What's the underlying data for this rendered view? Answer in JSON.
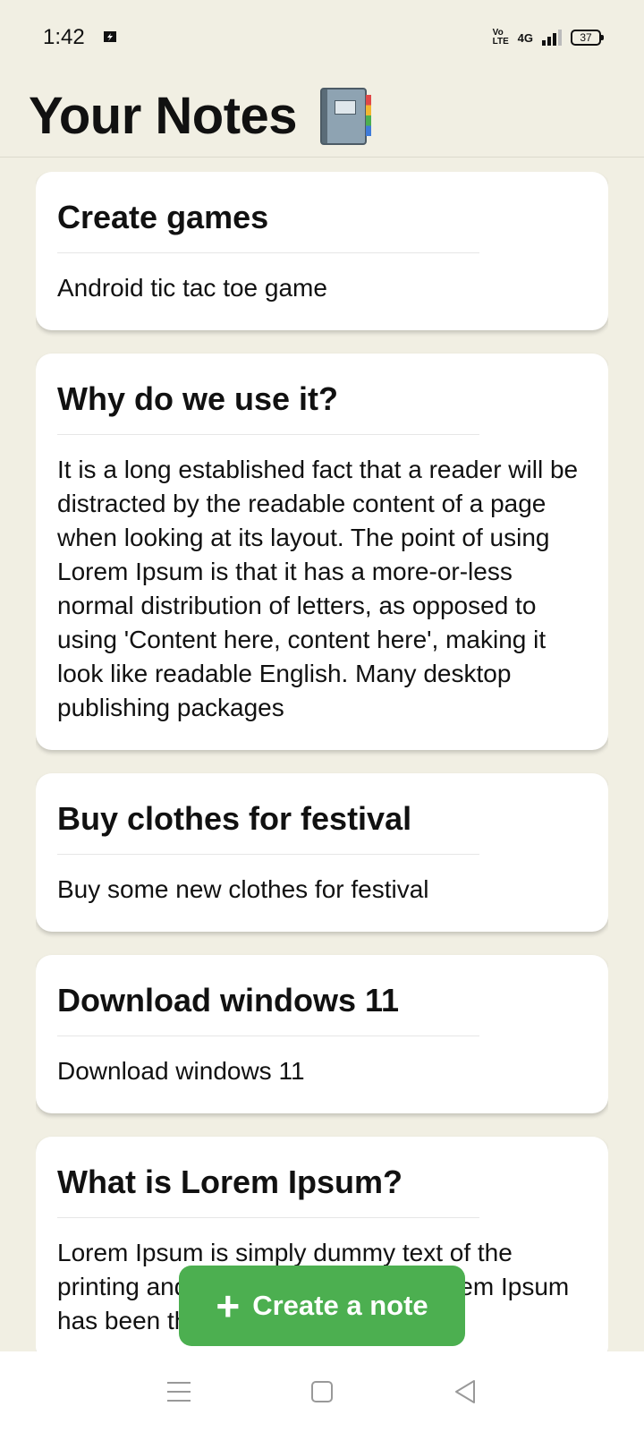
{
  "status_bar": {
    "time": "1:42",
    "network": "4G",
    "volte": "Vo LTE",
    "battery": "37"
  },
  "header": {
    "title": "Your Notes"
  },
  "notes": [
    {
      "title": "Create games",
      "body": "Android tic tac toe game"
    },
    {
      "title": "Why do we use it?",
      "body": "It is a long established fact that a reader will be distracted by the readable content of a page when looking at its layout. The point of using Lorem Ipsum is that it has a more-or-less normal distribution of letters, as opposed to using 'Content here, content here', making it look like readable English. Many desktop publishing packages"
    },
    {
      "title": "Buy clothes for festival",
      "body": "Buy some new clothes for festival"
    },
    {
      "title": "Download windows 11",
      "body": "Download windows 11"
    },
    {
      "title": "What is Lorem Ipsum?",
      "body": "Lorem Ipsum is simply dummy text of the printing and typesetting industry. Lorem Ipsum has been the industry's"
    }
  ],
  "fab": {
    "label": "Create a note",
    "icon": "plus-icon"
  },
  "nav_bar": {
    "icons": [
      "menu-icon",
      "home-icon",
      "back-icon"
    ]
  },
  "colors": {
    "background": "#f1efe3",
    "card": "#ffffff",
    "accent": "#4caf50"
  }
}
